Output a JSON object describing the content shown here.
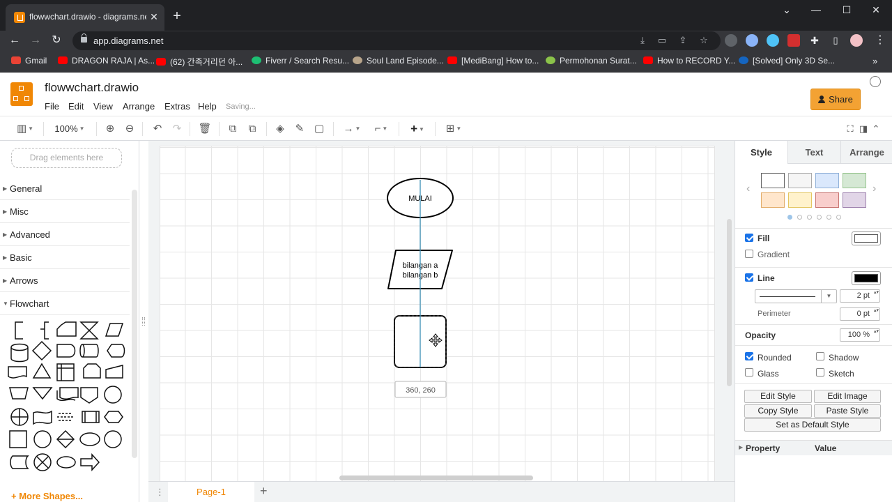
{
  "browser": {
    "tab_title": "flowwchart.drawio - diagrams.net",
    "url": "app.diagrams.net",
    "bookmarks": [
      {
        "label": "Gmail",
        "color": "#ea4335"
      },
      {
        "label": "DRAGON RAJA | As...",
        "color": "#ff0000"
      },
      {
        "label": "(62) 간족거리던 아...",
        "color": "#ff0000"
      },
      {
        "label": "Fiverr / Search Resu...",
        "color": "#1dbf73"
      },
      {
        "label": "Soul Land Episode...",
        "color": "#b7a48a"
      },
      {
        "label": "[MediBang] How to...",
        "color": "#ff0000"
      },
      {
        "label": "Permohonan Surat...",
        "color": "#8bc34a"
      },
      {
        "label": "How to RECORD Y...",
        "color": "#ff0000"
      },
      {
        "label": "[Solved] Only 3D Se...",
        "color": "#1565c0"
      }
    ]
  },
  "app": {
    "doc_title": "flowwchart.drawio",
    "menus": [
      "File",
      "Edit",
      "View",
      "Arrange",
      "Extras",
      "Help"
    ],
    "status": "Saving...",
    "share_label": "Share",
    "zoom": "100%"
  },
  "sidebar": {
    "search_placeholder": "Drag elements here",
    "sections": [
      "General",
      "Misc",
      "Advanced",
      "Basic",
      "Arrows",
      "Flowchart"
    ],
    "more_shapes": "More Shapes..."
  },
  "canvas": {
    "start_label": "MULAI",
    "io_line1": "bilangan a",
    "io_line2": "bilangan b",
    "coord_tooltip": "360, 260"
  },
  "pages": {
    "current": "Page-1"
  },
  "format_panel": {
    "tabs": [
      "Style",
      "Text",
      "Arrange"
    ],
    "swatches": [
      "#ffffff",
      "#f5f5f5",
      "#dae8fc",
      "#d5e8d4",
      "#ffe6cc",
      "#fff2cc",
      "#f8cecc",
      "#e1d5e7"
    ],
    "fill_label": "Fill",
    "gradient_label": "Gradient",
    "line_label": "Line",
    "line_width": "2 pt",
    "perimeter_label": "Perimeter",
    "perimeter_value": "0 pt",
    "opacity_label": "Opacity",
    "opacity_value": "100 %",
    "rounded_label": "Rounded",
    "shadow_label": "Shadow",
    "glass_label": "Glass",
    "sketch_label": "Sketch",
    "buttons": [
      "Edit Style",
      "Edit Image",
      "Copy Style",
      "Paste Style",
      "Set as Default Style"
    ],
    "property_header": "Property",
    "value_header": "Value",
    "fill_color": "#ffffff",
    "line_color": "#000000"
  }
}
